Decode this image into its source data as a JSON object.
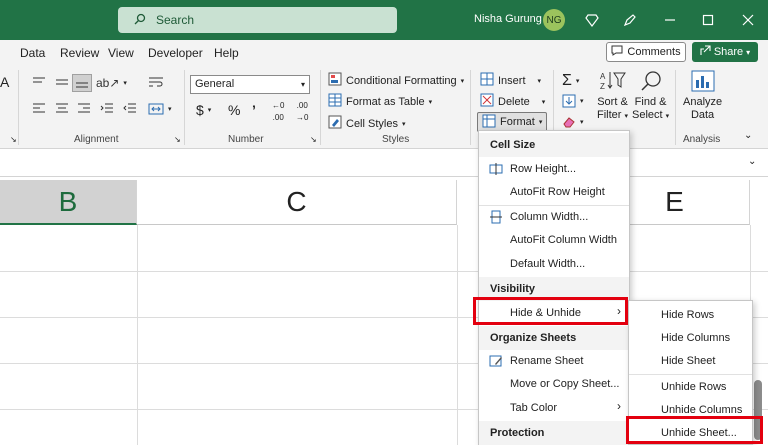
{
  "title_bar": {
    "search_placeholder": "Search",
    "user_name": "Nisha Gurung",
    "user_initials": "NG",
    "accent_color": "#217346"
  },
  "menubar": {
    "tabs": [
      "Data",
      "Review",
      "View",
      "Developer",
      "Help"
    ],
    "comments_label": "Comments",
    "share_label": "Share"
  },
  "ribbon": {
    "alignment_label": "Alignment",
    "number_format": "General",
    "number_label": "Number",
    "conditional_formatting": "Conditional Formatting",
    "format_as_table": "Format as Table",
    "cell_styles": "Cell Styles",
    "styles_label": "Styles",
    "insert": "Insert",
    "delete": "Delete",
    "format": "Format",
    "sort_filter_line1": "Sort &",
    "sort_filter_line2": "Filter",
    "find_select_line1": "Find &",
    "find_select_line2": "Select",
    "analyze_line1": "Analyze",
    "analyze_line2": "Data",
    "analysis_label": "Analysis",
    "partial_a": "A"
  },
  "columns": [
    "B",
    "C",
    "E"
  ],
  "format_menu": {
    "cell_size_header": "Cell Size",
    "row_height": "Row Height...",
    "autofit_row_height": "AutoFit Row Height",
    "column_width": "Column Width...",
    "autofit_column_width": "AutoFit Column Width",
    "default_width": "Default Width...",
    "visibility_header": "Visibility",
    "hide_unhide": "Hide & Unhide",
    "organize_header": "Organize Sheets",
    "rename_sheet": "Rename Sheet",
    "move_copy_sheet": "Move or Copy Sheet...",
    "tab_color": "Tab Color",
    "protection_header": "Protection"
  },
  "submenu": {
    "items": [
      "Hide Rows",
      "Hide Columns",
      "Hide Sheet",
      "Unhide Rows",
      "Unhide Columns",
      "Unhide Sheet..."
    ]
  }
}
